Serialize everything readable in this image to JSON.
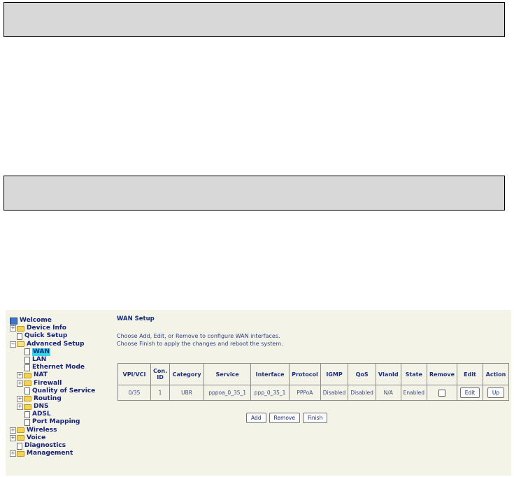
{
  "tree": {
    "welcome": "Welcome",
    "device_info": "Device Info",
    "quick_setup": "Quick Setup",
    "advanced_setup": "Advanced Setup",
    "wan": "WAN",
    "lan": "LAN",
    "ethernet_mode": "Ethernet Mode",
    "nat": "NAT",
    "firewall": "Firewall",
    "qos": "Quality of Service",
    "routing": "Routing",
    "dns": "DNS",
    "adsl": "ADSL",
    "port_mapping": "Port Mapping",
    "wireless": "Wireless",
    "voice": "Voice",
    "diagnostics": "Diagnostics",
    "management": "Management"
  },
  "main": {
    "title": "WAN Setup",
    "desc1": "Choose Add, Edit, or Remove to configure WAN interfaces.",
    "desc2": "Choose Finish to apply the changes and reboot the system."
  },
  "table": {
    "headers": [
      "VPI/VCI",
      "Con. ID",
      "Category",
      "Service",
      "Interface",
      "Protocol",
      "IGMP",
      "QoS",
      "VlanId",
      "State",
      "Remove",
      "Edit",
      "Action"
    ],
    "row": {
      "vpi_vci": "0/35",
      "con_id": "1",
      "category": "UBR",
      "service": "pppoa_0_35_1",
      "interface": "ppp_0_35_1",
      "protocol": "PPPoA",
      "igmp": "Disabled",
      "qos": "Disabled",
      "vlanid": "N/A",
      "state": "Enabled",
      "remove_checked": false,
      "edit_label": "Edit",
      "action_label": "Up"
    }
  },
  "buttons": {
    "add": "Add",
    "remove": "Remove",
    "finish": "Finish"
  }
}
